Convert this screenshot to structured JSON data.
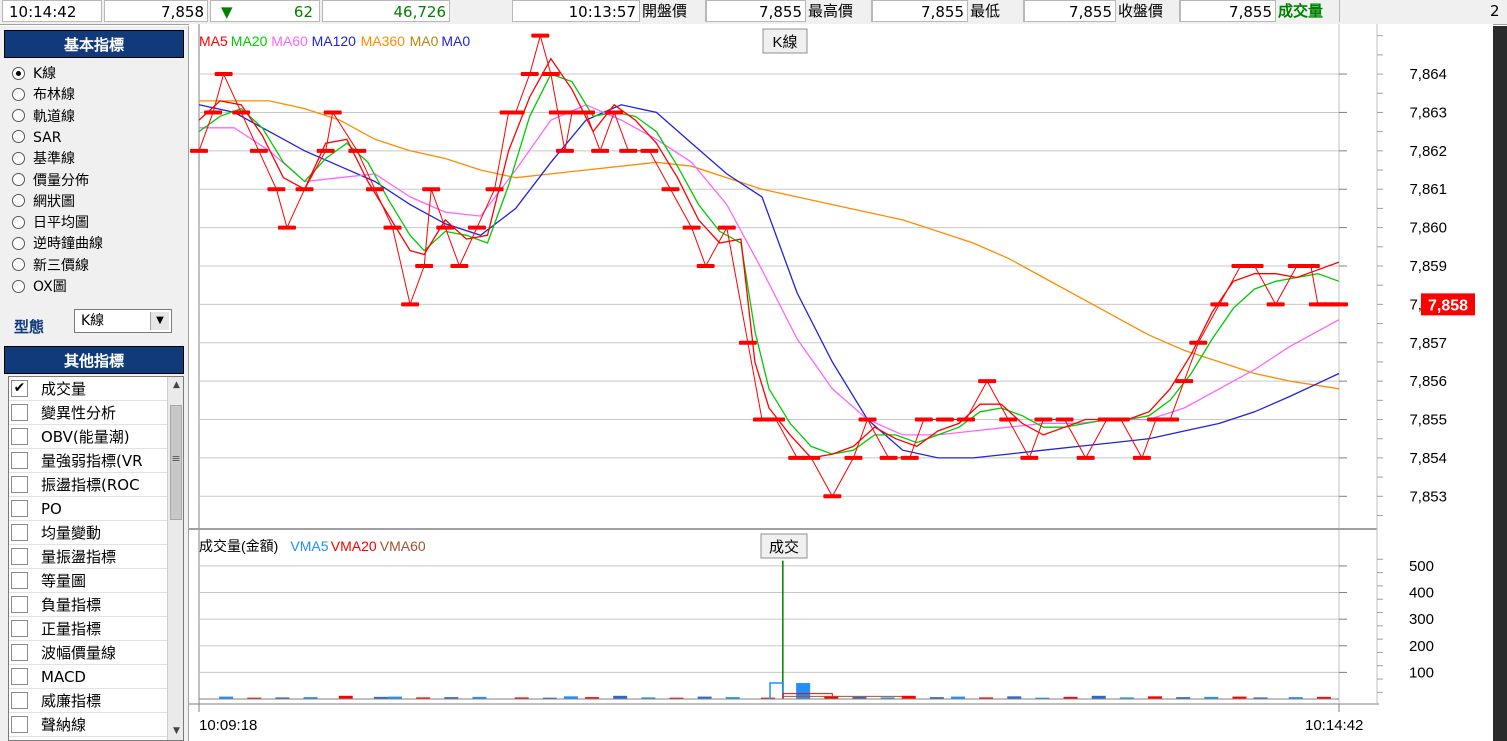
{
  "ticker": {
    "time": "10:14:42",
    "price": "7,858",
    "change_arrow": "▼",
    "change": "62",
    "volume": "46,726",
    "quote_time": "10:13:57",
    "open_label": "開盤價",
    "open": "7,855",
    "high_label": "最高價",
    "high": "7,855",
    "low_label": "最低",
    "low": "7,855",
    "close_label": "收盤價",
    "close": "7,855",
    "volume_label": "成交量",
    "edge_glyph": "2"
  },
  "basic_panel": {
    "title": "基本指標",
    "items": [
      "K線",
      "布林線",
      "軌道線",
      "SAR",
      "基準線",
      "價量分佈",
      "網狀圖",
      "日平均圖",
      "逆時鐘曲線",
      "新三價線",
      "OX圖"
    ],
    "selected_index": 0,
    "type_label": "型態",
    "type_value": "K線",
    "dropdown_arrow": "▼"
  },
  "other_panel": {
    "title": "其他指標",
    "items": [
      "成交量",
      "變異性分析",
      "OBV(能量潮)",
      "量強弱指標(VR",
      "振盪指標(ROC",
      "PO",
      "均量變動",
      "量振盪指標",
      "等量圖",
      "負量指標",
      "正量指標",
      "波幅價量線",
      "MACD",
      "威廉指標",
      "聲納線"
    ],
    "checked_index": 0,
    "check_mark": "✔",
    "scroll_up": "▲",
    "scroll_down": "▼",
    "scroll_mid": "≡"
  },
  "colors": {
    "ma5": "#ff0000",
    "ma20": "#00cc00",
    "ma60": "#ff66ff",
    "ma120": "#2222dd",
    "ma360": "#ff8c00",
    "ma0a": "#b8860b",
    "ma0b": "#2222dd",
    "vma5": "#1e90ff",
    "vma20": "#ff0000",
    "vma60": "#a0522d",
    "price_box": "#ff0000",
    "volume_spike": "#008000",
    "panel_header": "#103a7a"
  },
  "chart_data": [
    {
      "type": "line",
      "title_box": "K線",
      "legend": [
        {
          "name": "MA5",
          "color": "#ff0000"
        },
        {
          "name": "MA20",
          "color": "#00cc00"
        },
        {
          "name": "MA60",
          "color": "#ff66ff"
        },
        {
          "name": "MA120",
          "color": "#2222dd"
        },
        {
          "name": "MA360",
          "color": "#ff8c00"
        },
        {
          "name": "MA0",
          "color": "#b8860b"
        },
        {
          "name": "MA0",
          "color": "#2222dd"
        }
      ],
      "x_start_label": "10:09:18",
      "x_end_label": "10:14:42",
      "x_range": [
        0,
        324
      ],
      "ylim": [
        7852.2,
        7865.2
      ],
      "y_ticks": [
        7853,
        7854,
        7855,
        7856,
        7857,
        7858,
        7859,
        7860,
        7861,
        7862,
        7863,
        7864
      ],
      "y_tick_labels": [
        "7,853",
        "7,854",
        "7,855",
        "7,856",
        "7,857",
        "7,858",
        "7,859",
        "7,860",
        "7,861",
        "7,862",
        "7,863",
        "7,864"
      ],
      "current_price": 7858,
      "current_price_label": "7,858",
      "grid": true,
      "series": [
        {
          "key": "price",
          "x": [
            0,
            4,
            7,
            12,
            17,
            22,
            25,
            30,
            36,
            38,
            45,
            50,
            55,
            60,
            64,
            66,
            70,
            74,
            79,
            84,
            88,
            90,
            94,
            97,
            100,
            102,
            104,
            106,
            110,
            114,
            118,
            122,
            128,
            134,
            140,
            144,
            150,
            156,
            160,
            164,
            170,
            174,
            180,
            186,
            190,
            196,
            202,
            206,
            212,
            218,
            224,
            230,
            236,
            240,
            246,
            252,
            258,
            262,
            268,
            272,
            276,
            280,
            284,
            290,
            296,
            300,
            306,
            312,
            316,
            318,
            320,
            322,
            324
          ],
          "y": [
            7862,
            7863,
            7864,
            7863,
            7862,
            7861,
            7860,
            7861,
            7862,
            7863,
            7862,
            7861,
            7860,
            7858,
            7859,
            7861,
            7860,
            7859,
            7860,
            7861,
            7863,
            7863,
            7864,
            7865,
            7864,
            7863,
            7862,
            7863,
            7863,
            7862,
            7863,
            7862,
            7862,
            7861,
            7860,
            7859,
            7860,
            7857,
            7855,
            7855,
            7854,
            7854,
            7853,
            7854,
            7855,
            7854,
            7854,
            7855,
            7855,
            7855,
            7856,
            7855,
            7854,
            7855,
            7855,
            7854,
            7855,
            7855,
            7854,
            7855,
            7855,
            7856,
            7857,
            7858,
            7859,
            7859,
            7858,
            7859,
            7859,
            7858,
            7858,
            7858,
            7858
          ]
        },
        {
          "key": "ma5",
          "x": [
            0,
            6,
            12,
            18,
            24,
            30,
            36,
            42,
            48,
            54,
            60,
            64,
            70,
            76,
            82,
            88,
            94,
            100,
            106,
            112,
            118,
            124,
            130,
            136,
            142,
            148,
            154,
            158,
            162,
            168,
            174,
            180,
            186,
            192,
            198,
            204,
            210,
            216,
            222,
            228,
            234,
            240,
            246,
            252,
            258,
            264,
            270,
            276,
            282,
            288,
            294,
            300,
            306,
            312,
            318,
            324
          ],
          "y": [
            7862.8,
            7863.3,
            7863.2,
            7862.4,
            7861.3,
            7861,
            7862.2,
            7862.3,
            7861.2,
            7860.3,
            7859.4,
            7859.3,
            7860.2,
            7859.7,
            7859.8,
            7862,
            7863.4,
            7864.4,
            7863.6,
            7862.5,
            7863.2,
            7862.8,
            7862.2,
            7861.3,
            7860.2,
            7859.6,
            7859.7,
            7856.5,
            7855.3,
            7854.6,
            7854,
            7854.1,
            7854.3,
            7854.8,
            7854.5,
            7854.3,
            7854.7,
            7854.9,
            7855.4,
            7855.4,
            7854.9,
            7854.6,
            7854.8,
            7855,
            7855,
            7855,
            7855.2,
            7855.8,
            7856.7,
            7857.8,
            7858.6,
            7858.8,
            7858.8,
            7858.7,
            7858.9,
            7859.1
          ]
        },
        {
          "key": "ma20",
          "x": [
            0,
            6,
            12,
            18,
            24,
            30,
            36,
            42,
            48,
            54,
            60,
            64,
            70,
            76,
            82,
            88,
            94,
            100,
            106,
            112,
            118,
            124,
            130,
            136,
            142,
            148,
            154,
            158,
            162,
            168,
            174,
            180,
            186,
            192,
            198,
            204,
            210,
            216,
            222,
            228,
            234,
            240,
            246,
            252,
            258,
            264,
            270,
            276,
            282,
            288,
            294,
            300,
            306,
            312,
            318,
            324
          ],
          "y": [
            7862.5,
            7862.9,
            7863.1,
            7862.6,
            7861.7,
            7861.2,
            7861.8,
            7862.2,
            7861.7,
            7860.7,
            7859.8,
            7859.4,
            7859.9,
            7859.8,
            7859.6,
            7861.1,
            7862.9,
            7864,
            7863.8,
            7862.9,
            7863,
            7862.9,
            7862.5,
            7861.6,
            7860.6,
            7859.9,
            7859.6,
            7857.3,
            7855.8,
            7854.9,
            7854.3,
            7854.1,
            7854.2,
            7854.6,
            7854.6,
            7854.4,
            7854.6,
            7854.8,
            7855.2,
            7855.3,
            7855.1,
            7854.8,
            7854.8,
            7854.9,
            7855,
            7855,
            7855.1,
            7855.5,
            7856.2,
            7857.1,
            7857.9,
            7858.4,
            7858.6,
            7858.7,
            7858.8,
            7858.6
          ]
        },
        {
          "key": "ma60",
          "x": [
            0,
            10,
            20,
            30,
            40,
            50,
            60,
            70,
            80,
            90,
            100,
            110,
            120,
            130,
            140,
            150,
            160,
            170,
            180,
            190,
            200,
            210,
            220,
            230,
            240,
            250,
            260,
            270,
            280,
            290,
            300,
            310,
            318,
            324
          ],
          "y": [
            7862.6,
            7862.6,
            7862,
            7861.2,
            7861.3,
            7861.4,
            7860.8,
            7860.4,
            7860.3,
            7861.5,
            7862.8,
            7863.2,
            7862.8,
            7862.3,
            7861.7,
            7860.6,
            7858.9,
            7857.1,
            7855.8,
            7855,
            7854.6,
            7854.6,
            7854.7,
            7854.8,
            7854.9,
            7854.9,
            7855,
            7855,
            7855.3,
            7855.8,
            7856.3,
            7856.9,
            7857.3,
            7857.6
          ]
        },
        {
          "key": "ma120",
          "x": [
            0,
            10,
            20,
            30,
            40,
            50,
            60,
            70,
            80,
            90,
            100,
            110,
            115,
            120,
            130,
            140,
            150,
            160,
            170,
            180,
            190,
            200,
            210,
            220,
            230,
            240,
            250,
            260,
            270,
            280,
            290,
            300,
            310,
            324
          ],
          "y": [
            7863.2,
            7863,
            7862.5,
            7862,
            7861.6,
            7861.2,
            7860.6,
            7860.1,
            7859.8,
            7860.5,
            7861.7,
            7862.8,
            7863,
            7863.2,
            7863,
            7862.2,
            7861.4,
            7860.8,
            7858.3,
            7856.5,
            7855,
            7854.2,
            7854,
            7854,
            7854.1,
            7854.2,
            7854.3,
            7854.4,
            7854.5,
            7854.7,
            7854.9,
            7855.2,
            7855.6,
            7856.2
          ]
        },
        {
          "key": "ma360",
          "x": [
            0,
            10,
            20,
            30,
            40,
            50,
            60,
            70,
            80,
            90,
            100,
            110,
            120,
            130,
            140,
            150,
            160,
            170,
            180,
            190,
            200,
            210,
            220,
            230,
            240,
            250,
            260,
            270,
            280,
            290,
            300,
            310,
            324
          ],
          "y": [
            7863.3,
            7863.3,
            7863.3,
            7863.1,
            7862.8,
            7862.3,
            7862,
            7861.8,
            7861.5,
            7861.3,
            7861.4,
            7861.5,
            7861.6,
            7861.7,
            7861.6,
            7861.3,
            7861,
            7860.8,
            7860.6,
            7860.4,
            7860.2,
            7859.9,
            7859.6,
            7859.2,
            7858.7,
            7858.2,
            7857.7,
            7857.2,
            7856.8,
            7856.5,
            7856.2,
            7856.0,
            7855.8
          ]
        }
      ]
    },
    {
      "type": "bar",
      "title_box": "成交",
      "legend": [
        {
          "name": "成交量(金額)",
          "color": "#000000"
        },
        {
          "name": "VMA5",
          "color": "#1e90ff"
        },
        {
          "name": "VMA20",
          "color": "#ff0000"
        },
        {
          "name": "VMA60",
          "color": "#a0522d"
        }
      ],
      "ylim": [
        0,
        620
      ],
      "y_ticks": [
        100,
        200,
        300,
        400,
        500
      ],
      "y_tick_labels": [
        "100",
        "200",
        "300",
        "400",
        "500"
      ],
      "grid": true,
      "x": [
        6,
        14,
        22,
        30,
        40,
        50,
        54,
        62,
        70,
        78,
        90,
        98,
        104,
        110,
        118,
        126,
        134,
        142,
        150,
        160,
        166,
        170,
        178,
        186,
        194,
        200,
        208,
        214,
        222,
        230,
        238,
        246,
        254,
        262,
        270,
        278,
        286,
        294,
        300,
        310,
        318
      ],
      "values": [
        9,
        5,
        6,
        7,
        12,
        8,
        9,
        6,
        7,
        8,
        6,
        5,
        10,
        7,
        12,
        6,
        5,
        9,
        7,
        5,
        520,
        60,
        10,
        8,
        6,
        12,
        7,
        9,
        6,
        10,
        5,
        8,
        12,
        6,
        10,
        7,
        8,
        9,
        6,
        7,
        8
      ]
    }
  ]
}
